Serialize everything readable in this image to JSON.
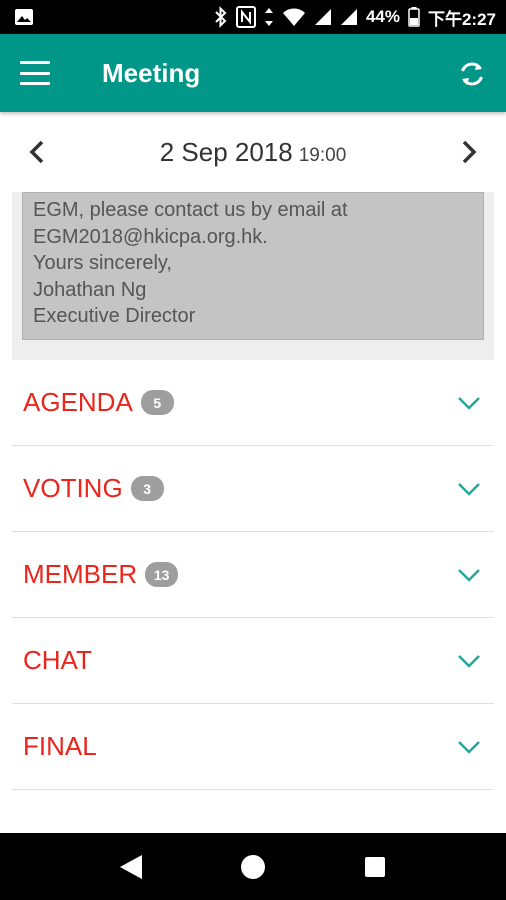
{
  "status_bar": {
    "battery": "44%",
    "time": "下午2:27",
    "icons": [
      "image-icon",
      "bluetooth-icon",
      "nfc-icon",
      "data-arrows-icon",
      "wifi-icon",
      "signal-icon",
      "signal-icon",
      "battery-icon"
    ]
  },
  "header": {
    "title": "Meeting",
    "menu_icon": "hamburger-menu-icon",
    "refresh_icon": "refresh-icon"
  },
  "date_nav": {
    "date": "2 Sep 2018",
    "time": "19:00",
    "prev_icon": "chevron-left-icon",
    "next_icon": "chevron-right-icon"
  },
  "letter": {
    "lines": [
      "EGM, please contact us by email at",
      "EGM2018@hkicpa.org.hk.",
      "Yours sincerely,",
      "Johathan Ng",
      "Executive Director"
    ]
  },
  "sections": [
    {
      "title": "AGENDA",
      "count": "5"
    },
    {
      "title": "VOTING",
      "count": "3"
    },
    {
      "title": "MEMBER",
      "count": "13"
    },
    {
      "title": "CHAT",
      "count": ""
    },
    {
      "title": "FINAL",
      "count": ""
    }
  ],
  "colors": {
    "app_bar": "#009688",
    "section_title": "#e8261b",
    "badge": "#9e9e9e",
    "chevron": "#26a69a"
  },
  "nav_bar": {
    "icons": [
      "back-triangle-icon",
      "home-circle-icon",
      "recents-square-icon"
    ]
  }
}
